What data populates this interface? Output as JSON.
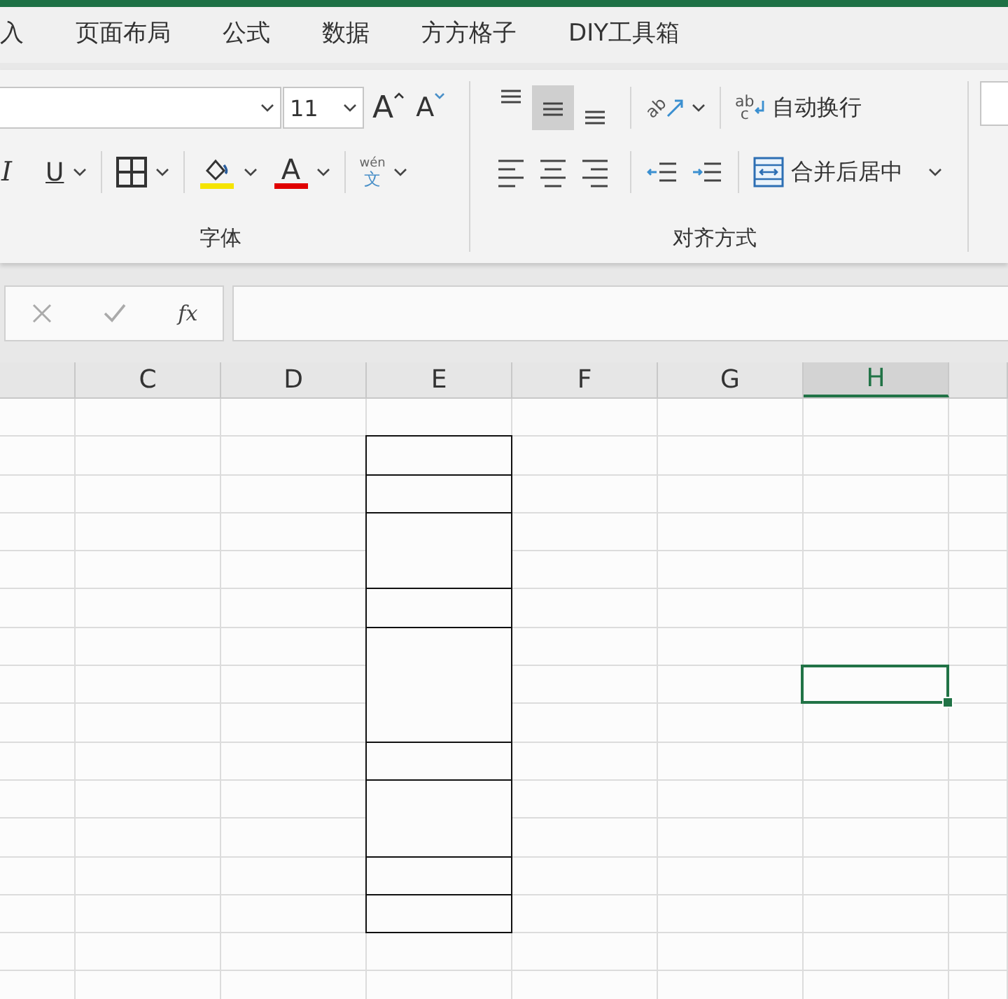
{
  "tabs": [
    {
      "label": "入",
      "selected": false
    },
    {
      "label": "页面布局",
      "selected": false
    },
    {
      "label": "公式",
      "selected": false
    },
    {
      "label": "数据",
      "selected": false
    },
    {
      "label": "方方格子",
      "selected": false
    },
    {
      "label": "DIY工具箱",
      "selected": false
    }
  ],
  "font_group": {
    "label": "字体",
    "font_size": "11",
    "grow_font": "A",
    "shrink_font": "A",
    "italic": "I",
    "underline": "U",
    "font_color": "A",
    "phonetic_top": "wén",
    "phonetic_bottom": "文"
  },
  "alignment_group": {
    "label": "对齐方式",
    "vertical": [
      {
        "kind": "top",
        "selected": false
      },
      {
        "kind": "middle",
        "selected": true
      },
      {
        "kind": "bottom",
        "selected": false
      }
    ],
    "horizontal": [
      {
        "kind": "left",
        "selected": false
      },
      {
        "kind": "center",
        "selected": false
      },
      {
        "kind": "right",
        "selected": false
      }
    ],
    "orientation_icon": "ab",
    "wrap_icon_top": "ab",
    "wrap_icon_bottom": "c",
    "wrap_text": "自动换行",
    "merge_center": "合并后居中"
  },
  "formula_bar": {
    "function_label": "fx"
  },
  "grid": {
    "columns": [
      {
        "selected": false
      },
      {
        "label": "C",
        "selected": false
      },
      {
        "label": "D",
        "selected": false
      },
      {
        "label": "E",
        "selected": false
      },
      {
        "label": "F",
        "selected": false
      },
      {
        "label": "G",
        "selected": false
      },
      {
        "label": "H",
        "selected": true
      }
    ],
    "rows": [
      {
        "selected": false
      },
      {
        "selected": false
      },
      {
        "selected": false
      },
      {
        "selected": false
      },
      {
        "selected": false
      },
      {
        "selected": false
      },
      {
        "selected": false
      },
      {
        "selected": true
      },
      {
        "selected": false
      },
      {
        "selected": false
      },
      {
        "selected": false
      },
      {
        "selected": false
      },
      {
        "selected": false
      },
      {
        "selected": false
      },
      {
        "selected": false
      },
      {
        "selected": false
      }
    ],
    "border_blocks": [
      {
        "kind": "single"
      },
      {
        "kind": "single"
      },
      {
        "kind": "double"
      },
      {
        "kind": "single"
      },
      {
        "kind": "triple"
      },
      {
        "kind": "single"
      },
      {
        "kind": "double"
      },
      {
        "kind": "single"
      },
      {
        "kind": "single"
      }
    ]
  }
}
